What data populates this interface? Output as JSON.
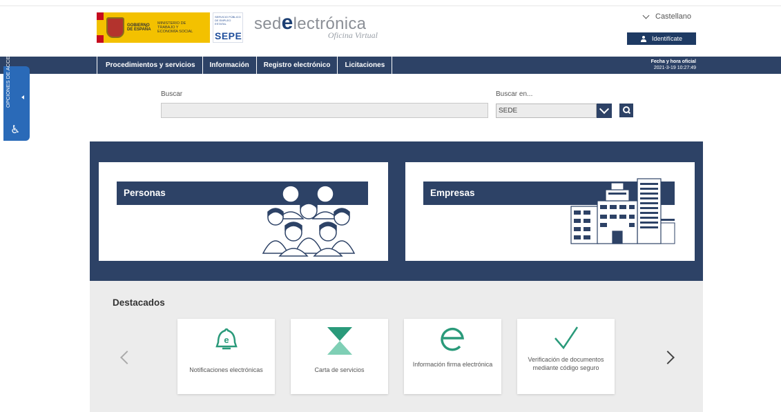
{
  "header": {
    "gov_logo": {
      "line1": "GOBIERNO DE ESPAÑA",
      "line2": "MINISTERIO DE TRABAJO Y ECONOMÍA SOCIAL"
    },
    "sepe_logo": {
      "small": "SERVICIO PÚBLICO DE EMPLEO ESTATAL",
      "big": "SEPE"
    },
    "sede_logo": {
      "prefix": "sed",
      "e": "e",
      "suffix": "lectrónica",
      "subtitle": "Oficina Virtual"
    },
    "language": "Castellano",
    "login_label": "Identifícate"
  },
  "nav": {
    "items": [
      {
        "label": "Procedimientos y servicios"
      },
      {
        "label": "Información"
      },
      {
        "label": "Registro electrónico"
      },
      {
        "label": "Licitaciones"
      }
    ],
    "datetime_title": "Fecha y hora oficial",
    "datetime_value": "2021-3-19   10:27:49"
  },
  "accessibility": {
    "label": "OPCIONES DE ACCESIBILIDAD"
  },
  "search": {
    "label": "Buscar",
    "value": "",
    "search_in_label": "Buscar en...",
    "search_in_value": "SEDE"
  },
  "hero": {
    "cards": [
      {
        "label": "Personas",
        "illustration": "people-group-icon"
      },
      {
        "label": "Empresas",
        "illustration": "buildings-icon"
      }
    ]
  },
  "destacados": {
    "title": "Destacados",
    "items": [
      {
        "label": "Notificaciones electrónicas",
        "icon": "bell-e-icon"
      },
      {
        "label": "Carta de servicios",
        "icon": "hourglass-icon"
      },
      {
        "label": "Información firma electrónica",
        "icon": "e-icon"
      },
      {
        "label": "Verificación de documentos mediante código seguro",
        "icon": "checkmark-icon"
      }
    ]
  },
  "colors": {
    "navy": "#2d4266",
    "accent_green": "#2a9a7a",
    "accessibility_blue": "#2a6ab8"
  }
}
